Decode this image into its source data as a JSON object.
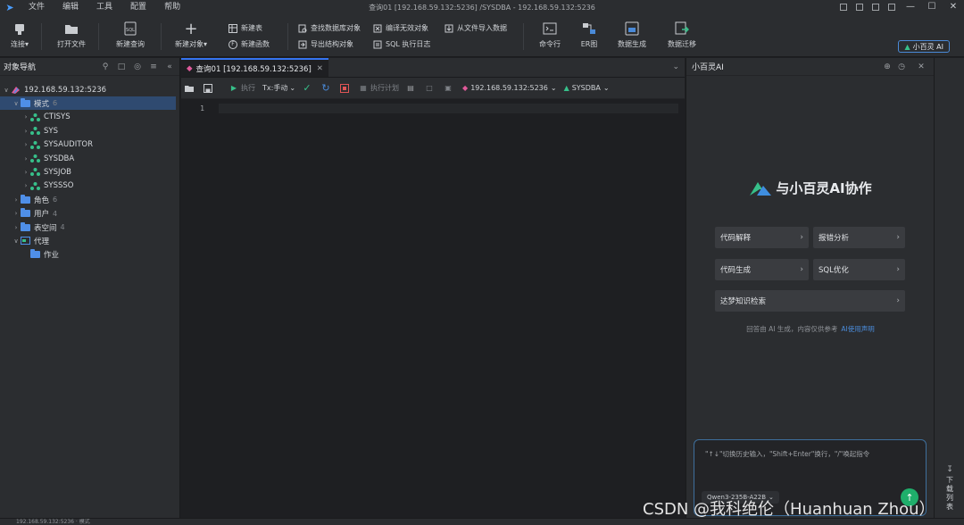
{
  "menus": [
    "文件",
    "编辑",
    "工具",
    "配置",
    "帮助"
  ],
  "window_title": "查询01 [192.168.59.132:5236] /SYSDBA  - 192.168.59.132:5236",
  "toolbar": {
    "connect": "连接",
    "open_file": "打开文件",
    "new_query": "新建查询",
    "new_object": "新建对象",
    "new_table": "新建表",
    "new_function": "新建函数",
    "find_db_object": "查找数据库对象",
    "export_structure": "导出结构对象",
    "compile_invalid": "编译无效对象",
    "sql_log": "SQL 执行日志",
    "import_from_file": "从文件导入数据",
    "command_line": "命令行",
    "er_diagram": "ER图",
    "data_generation": "数据生成",
    "data_migration": "数据迁移",
    "ai_badge": "小百灵 AI"
  },
  "left_panel": {
    "title": "对象导航",
    "tree": [
      {
        "label": "192.168.59.132:5236",
        "count": "",
        "level": 0,
        "expanded": true,
        "icon": "connection"
      },
      {
        "label": "模式",
        "count": "6",
        "level": 1,
        "expanded": true,
        "icon": "folder",
        "selected": true
      },
      {
        "label": "CTISYS",
        "count": "",
        "level": 2,
        "expanded": false,
        "icon": "schema"
      },
      {
        "label": "SYS",
        "count": "",
        "level": 2,
        "expanded": false,
        "icon": "schema"
      },
      {
        "label": "SYSAUDITOR",
        "count": "",
        "level": 2,
        "expanded": false,
        "icon": "schema"
      },
      {
        "label": "SYSDBA",
        "count": "",
        "level": 2,
        "expanded": false,
        "icon": "schema"
      },
      {
        "label": "SYSJOB",
        "count": "",
        "level": 2,
        "expanded": false,
        "icon": "schema"
      },
      {
        "label": "SYSSSO",
        "count": "",
        "level": 2,
        "expanded": false,
        "icon": "schema"
      },
      {
        "label": "角色",
        "count": "6",
        "level": 1,
        "expanded": false,
        "icon": "folder"
      },
      {
        "label": "用户",
        "count": "4",
        "level": 1,
        "expanded": false,
        "icon": "folder"
      },
      {
        "label": "表空间",
        "count": "4",
        "level": 1,
        "expanded": false,
        "icon": "folder"
      },
      {
        "label": "代理",
        "count": "",
        "level": 1,
        "expanded": true,
        "icon": "agent"
      },
      {
        "label": "作业",
        "count": "",
        "level": 2,
        "expanded": null,
        "icon": "folder"
      }
    ]
  },
  "editor": {
    "tab_label": "查询01 [192.168.59.132:5236]",
    "execute": "执行",
    "tx_mode": "Tx:手动",
    "execution_plan": "执行计划",
    "connection": "192.168.59.132:5236",
    "schema": "SYSDBA",
    "line_number": "1"
  },
  "ai_panel": {
    "title": "小百灵AI",
    "heading": "与小百灵AI协作",
    "cards": [
      "代码解释",
      "报错分析",
      "代码生成",
      "SQL优化",
      "达梦知识检索"
    ],
    "footnote": "回答由 AI 生成，内容仅供参考",
    "footnote_link": "AI使用声明",
    "input_placeholder": "\"↑↓\"切换历史输入，\"Shift+Enter\"换行，\"/\"唤起指令",
    "model": "Qwen3-235B-A22B"
  },
  "right_strip": {
    "download_chars": [
      "下",
      "载",
      "列",
      "表"
    ]
  },
  "statusbar": {
    "text": "192.168.59.132:5236 · 模式"
  },
  "watermark": "CSDN @我科绝伦（Huanhuan Zhou）",
  "colors": {
    "accent": "#3574f0",
    "ai_link": "#4a8ad8",
    "send": "#1fae6b",
    "folder": "#4f8fe8",
    "schema": "#37c08a"
  }
}
